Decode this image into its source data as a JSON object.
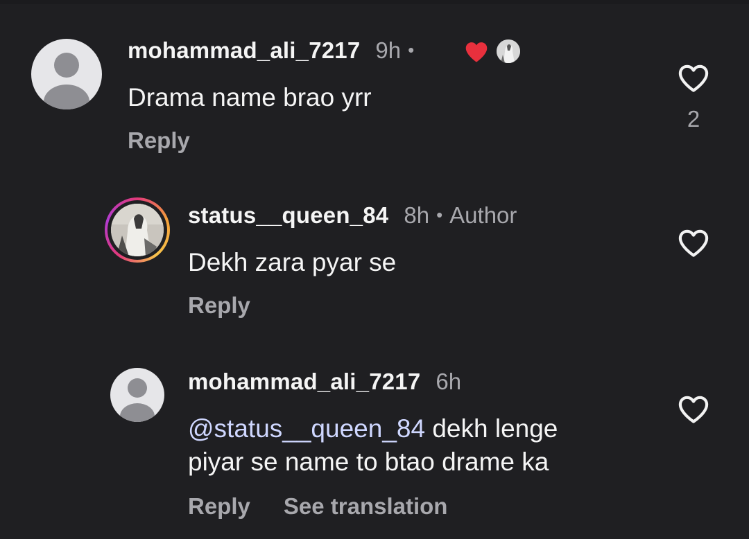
{
  "comments": [
    {
      "username": "mohammad_ali_7217",
      "time": "9h",
      "separator": "•",
      "text": "Drama name brao yrr",
      "reply_label": "Reply",
      "like_count": "2",
      "liked_by_author": true
    },
    {
      "username": "status__queen_84",
      "time": "8h",
      "separator": "•",
      "badge": "Author",
      "text": "Dekh zara pyar se",
      "reply_label": "Reply"
    },
    {
      "username": "mohammad_ali_7217",
      "time": "6h",
      "mention": "@status__queen_84",
      "text_line1_rest": " dekh lenge",
      "text_line2": "piyar se name to btao drame ka",
      "reply_label": "Reply",
      "translate_label": "See translation"
    }
  ],
  "icons": {
    "like": "heart-outline-icon",
    "creator_like": "heart-filled-icon",
    "default_avatar": "default-avatar-icon"
  },
  "colors": {
    "background": "#1f1f22",
    "creator_heart": "#e8303d",
    "secondary_text": "#a8a8ad"
  }
}
